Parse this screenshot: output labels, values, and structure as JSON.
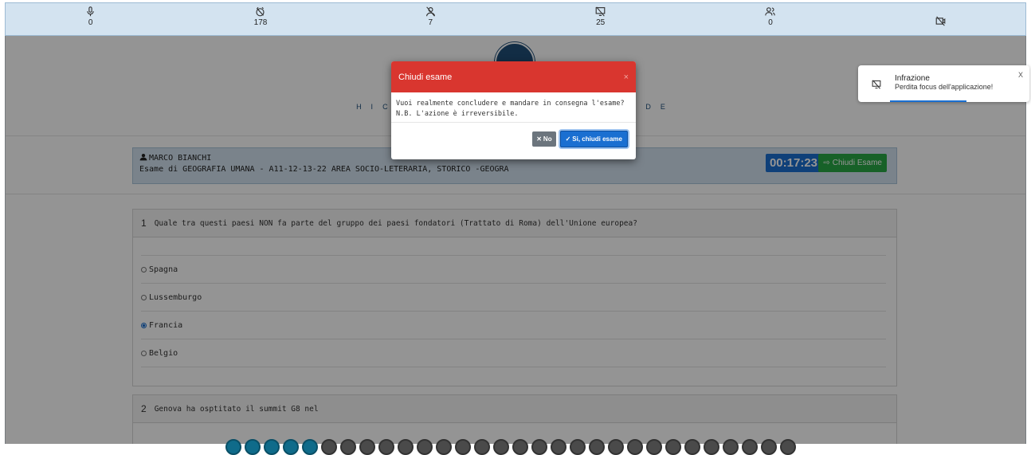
{
  "stats": [
    {
      "icon": "microphone-icon",
      "value": "0"
    },
    {
      "icon": "no-eye-icon",
      "value": "178"
    },
    {
      "icon": "person-off-icon",
      "value": "7"
    },
    {
      "icon": "focus-lost-icon",
      "value": "25"
    },
    {
      "icon": "multiple-people-icon",
      "value": "0"
    },
    {
      "icon": "camera-off-icon",
      "value": ""
    }
  ],
  "header": {
    "motto": "HIC ET NUNC SAPERE AUDE"
  },
  "student": {
    "name": "MARCO BIANCHI",
    "exam": "Esame di GEOGRAFIA UMANA - A11-12-13-22 AREA SOCIO-LETERARIA, STORICO -GEOGRA",
    "timer": "00:17:23",
    "close_label": "Chiudi Esame"
  },
  "questions": [
    {
      "number": "1",
      "text": "Quale tra questi paesi NON fa parte del gruppo dei paesi fondatori (Trattato di Roma) dell'Unione europea?",
      "options": [
        "Spagna",
        "Lussemburgo",
        "Francia",
        "Belgio"
      ],
      "selected": "Francia"
    },
    {
      "number": "2",
      "text": "Genova ha osptitato il summit G8 nel"
    }
  ],
  "modal": {
    "title": "Chiudi esame",
    "close_glyph": "×",
    "line1": "Vuoi realmente concludere e mandare in consegna l'esame?",
    "line2": "N.B. L'azione è irreversibile.",
    "no_label": "No",
    "yes_label": "Si, chiudi esame"
  },
  "toast": {
    "title": "Infrazione",
    "message": "Perdita focus dell'applicazione!",
    "close": "X"
  },
  "pager": {
    "completed": 5,
    "total": 30
  },
  "colors": {
    "danger": "#d9362f",
    "primary": "#1a6fd1",
    "success": "#28a745",
    "statsbar": "#d3e3f0"
  }
}
